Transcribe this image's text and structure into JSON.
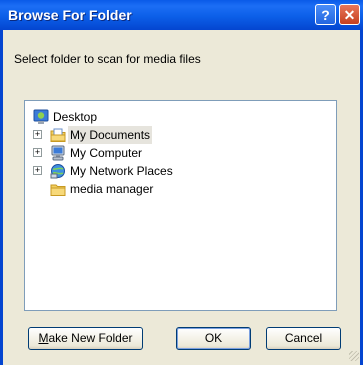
{
  "dialog": {
    "title": "Browse For Folder",
    "help_glyph": "?",
    "close_glyph": "✕",
    "description": "Select folder to scan for media files"
  },
  "tree": {
    "items": [
      {
        "label": "Desktop",
        "icon": "desktop-icon",
        "expander": ""
      },
      {
        "label": "My Documents",
        "icon": "my-documents-folder-icon",
        "expander": "+",
        "selected": true
      },
      {
        "label": "My Computer",
        "icon": "my-computer-icon",
        "expander": "+"
      },
      {
        "label": "My Network Places",
        "icon": "network-places-icon",
        "expander": "+"
      },
      {
        "label": "media manager",
        "icon": "folder-icon",
        "expander": ""
      }
    ]
  },
  "buttons": {
    "make_new_folder": "Make New Folder",
    "ok": "OK",
    "cancel": "Cancel"
  },
  "colors": {
    "titlebar": "#0c5fe8",
    "dialog_bg": "#ece9d8",
    "tree_border": "#7f9db9"
  }
}
